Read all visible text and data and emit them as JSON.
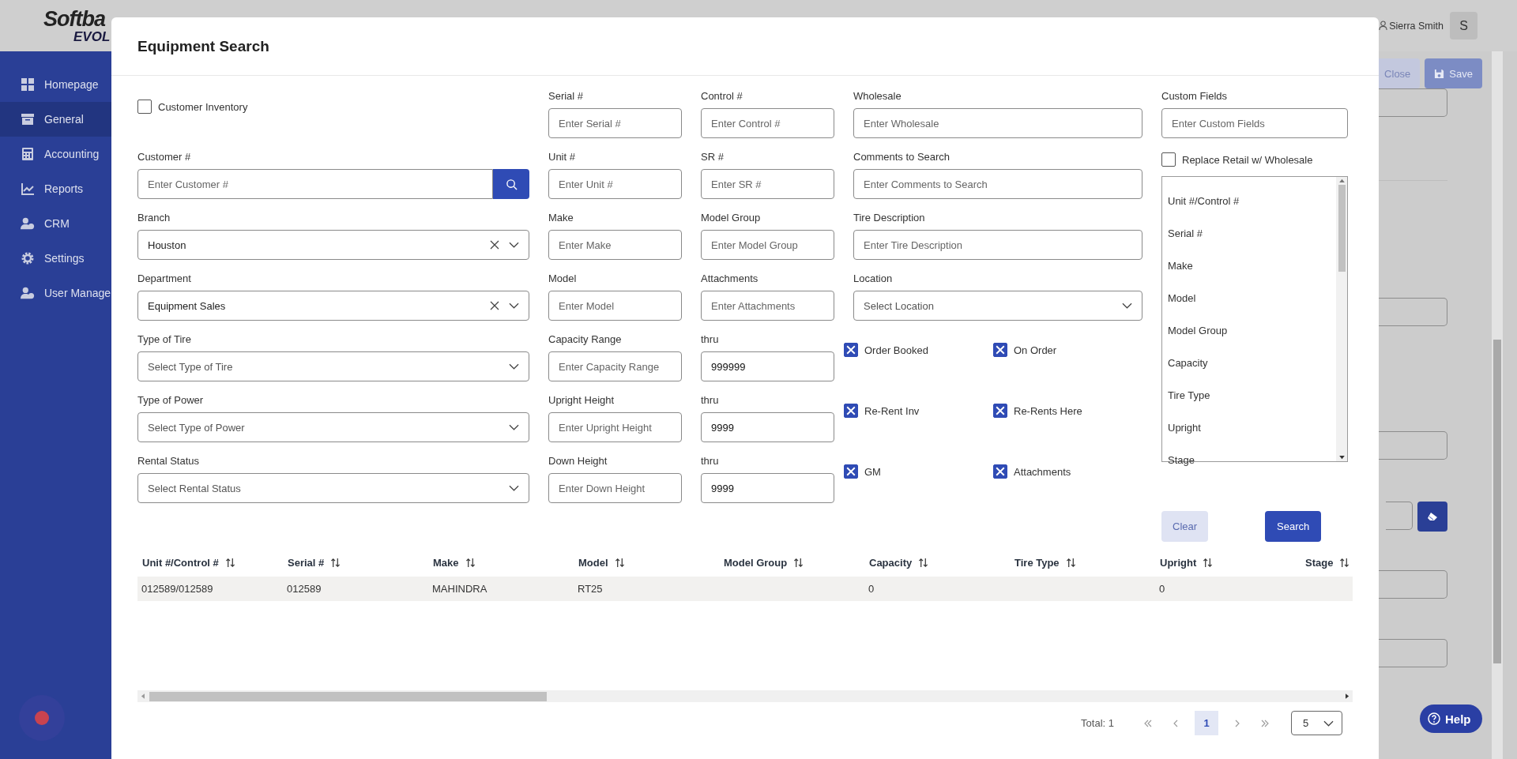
{
  "app": {
    "logo": {
      "line1": "Softba",
      "line2": "EVOL"
    },
    "sidebar": [
      {
        "label": "Homepage",
        "selected": false
      },
      {
        "label": "General",
        "selected": true
      },
      {
        "label": "Accounting",
        "selected": false
      },
      {
        "label": "Reports",
        "selected": false
      },
      {
        "label": "CRM",
        "selected": false
      },
      {
        "label": "Settings",
        "selected": false
      },
      {
        "label": "User Manage",
        "selected": false
      }
    ],
    "user": {
      "name": "Sierra Smith",
      "initial": "S"
    },
    "toolbar": [
      {
        "label": "Close",
        "kind": "secondary"
      },
      {
        "label": "Save",
        "kind": "primary"
      }
    ],
    "help": {
      "label": "Help"
    }
  },
  "dialog": {
    "title": "Equipment Search",
    "columns": [
      [
        {
          "kind": "checkbox",
          "label": "Customer Inventory",
          "checked": false
        },
        {
          "kind": "search",
          "label": "Customer #",
          "placeholder": "Enter Customer #"
        },
        {
          "kind": "select",
          "label": "Branch",
          "value": "Houston"
        },
        {
          "kind": "select",
          "label": "Department",
          "value": "Equipment Sales"
        },
        {
          "kind": "select",
          "label": "Type of Tire",
          "placeholder": "Select Type of Tire"
        },
        {
          "kind": "select",
          "label": "Type of Power",
          "placeholder": "Select Type of Power"
        },
        {
          "kind": "select",
          "label": "Rental Status",
          "placeholder": "Select Rental Status"
        }
      ],
      [
        {
          "kind": "text",
          "label": "Serial #",
          "placeholder": "Enter Serial #"
        },
        {
          "kind": "text",
          "label": "Unit #",
          "placeholder": "Enter Unit #"
        },
        {
          "kind": "text",
          "label": "Make",
          "placeholder": "Enter Make"
        },
        {
          "kind": "text",
          "label": "Model",
          "placeholder": "Enter Model"
        },
        {
          "kind": "text",
          "label": "Capacity Range",
          "placeholder": "Enter Capacity Range"
        },
        {
          "kind": "text",
          "label": "Upright Height",
          "placeholder": "Enter Upright Height"
        },
        {
          "kind": "text",
          "label": "Down Height",
          "placeholder": "Enter Down Height"
        }
      ],
      [
        {
          "kind": "text",
          "label": "Control #",
          "placeholder": "Enter Control #"
        },
        {
          "kind": "text",
          "label": "SR #",
          "placeholder": "Enter SR #"
        },
        {
          "kind": "text",
          "label": "Model Group",
          "placeholder": "Enter Model Group"
        },
        {
          "kind": "text",
          "label": "Attachments",
          "placeholder": "Enter Attachments"
        },
        {
          "kind": "text",
          "label": "thru",
          "value": "999999"
        },
        {
          "kind": "text",
          "label": "thru",
          "value": "9999"
        },
        {
          "kind": "text",
          "label": "thru",
          "value": "9999"
        }
      ],
      [
        {
          "kind": "text",
          "label": "Wholesale",
          "placeholder": "Enter Wholesale"
        },
        {
          "kind": "text",
          "label": "Comments to Search",
          "placeholder": "Enter Comments to Search"
        },
        {
          "kind": "text",
          "label": "Tire Description",
          "placeholder": "Enter Tire Description"
        },
        {
          "kind": "select",
          "label": "Location",
          "placeholder": "Select Location"
        },
        {
          "kind": "checks",
          "items": [
            {
              "label": "Order Booked",
              "checked": true
            },
            {
              "label": "On Order",
              "checked": true
            }
          ]
        },
        {
          "kind": "checks",
          "items": [
            {
              "label": "Re-Rent Inv",
              "checked": true
            },
            {
              "label": "Re-Rents Here",
              "checked": true
            }
          ]
        },
        {
          "kind": "checks",
          "items": [
            {
              "label": "GM",
              "checked": true
            },
            {
              "label": "Attachments",
              "checked": true
            }
          ]
        }
      ],
      [
        {
          "kind": "text",
          "label": "Custom Fields",
          "placeholder": "Enter Custom Fields"
        },
        {
          "kind": "checkbox",
          "label": "Replace Retail w/ Wholesale",
          "checked": false
        },
        {
          "kind": "listbox",
          "options": [
            "Unit #/Control #",
            "Serial #",
            "Make",
            "Model",
            "Model Group",
            "Capacity",
            "Tire Type",
            "Upright",
            "Stage"
          ]
        }
      ]
    ],
    "actions": [
      {
        "label": "Clear",
        "kind": "secondary"
      },
      {
        "label": "Search",
        "kind": "primary"
      }
    ],
    "table": {
      "columns": [
        "Unit #/Control #",
        "Serial #",
        "Make",
        "Model",
        "Model Group",
        "Capacity",
        "Tire Type",
        "Upright",
        "Stage"
      ],
      "rows": [
        {
          "cells": [
            "012589/012589",
            "012589",
            "MAHINDRA",
            "RT25",
            null,
            "0",
            null,
            "0",
            null
          ]
        }
      ]
    },
    "pagination": {
      "total": "Total: 1",
      "pages": [
        {
          "label": "1",
          "selected": true
        }
      ],
      "page_size": "5"
    }
  }
}
